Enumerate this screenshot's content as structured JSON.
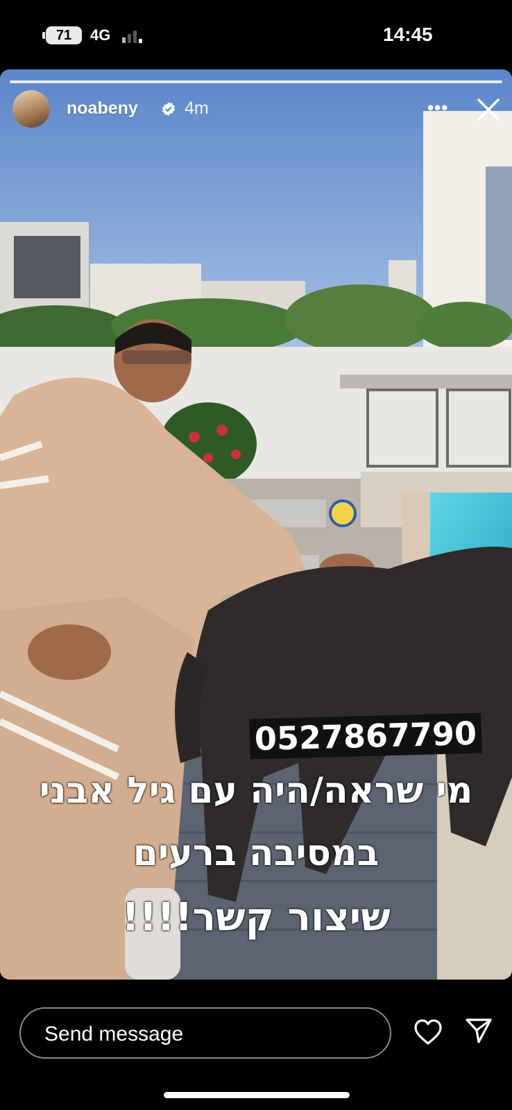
{
  "status_bar": {
    "battery": "71",
    "network": "4G",
    "time": "14:45"
  },
  "story": {
    "username": "noabeny",
    "verified": true,
    "posted_ago": "4m",
    "more_label": "•••",
    "phone_number": "0527867790",
    "caption_lines": [
      "מי שראה/היה עם גיל אבני",
      "במסיבה ברעים",
      "שיצור קשר!!!!"
    ]
  },
  "footer": {
    "message_placeholder": "Send message"
  },
  "icons": {
    "more": "more-dots-icon",
    "close": "close-icon",
    "like": "heart-icon",
    "share": "send-arrow-icon",
    "verified": "verified-badge-icon"
  },
  "colors": {
    "background": "#000000",
    "text": "#ffffff",
    "verified": "#ffffff"
  }
}
